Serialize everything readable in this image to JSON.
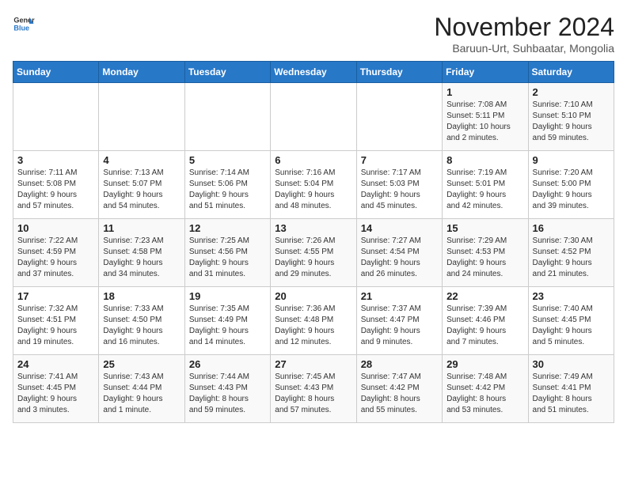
{
  "logo": {
    "line1": "General",
    "line2": "Blue"
  },
  "title": "November 2024",
  "subtitle": "Baruun-Urt, Suhbaatar, Mongolia",
  "weekdays": [
    "Sunday",
    "Monday",
    "Tuesday",
    "Wednesday",
    "Thursday",
    "Friday",
    "Saturday"
  ],
  "weeks": [
    [
      {
        "day": "",
        "info": ""
      },
      {
        "day": "",
        "info": ""
      },
      {
        "day": "",
        "info": ""
      },
      {
        "day": "",
        "info": ""
      },
      {
        "day": "",
        "info": ""
      },
      {
        "day": "1",
        "info": "Sunrise: 7:08 AM\nSunset: 5:11 PM\nDaylight: 10 hours\nand 2 minutes."
      },
      {
        "day": "2",
        "info": "Sunrise: 7:10 AM\nSunset: 5:10 PM\nDaylight: 9 hours\nand 59 minutes."
      }
    ],
    [
      {
        "day": "3",
        "info": "Sunrise: 7:11 AM\nSunset: 5:08 PM\nDaylight: 9 hours\nand 57 minutes."
      },
      {
        "day": "4",
        "info": "Sunrise: 7:13 AM\nSunset: 5:07 PM\nDaylight: 9 hours\nand 54 minutes."
      },
      {
        "day": "5",
        "info": "Sunrise: 7:14 AM\nSunset: 5:06 PM\nDaylight: 9 hours\nand 51 minutes."
      },
      {
        "day": "6",
        "info": "Sunrise: 7:16 AM\nSunset: 5:04 PM\nDaylight: 9 hours\nand 48 minutes."
      },
      {
        "day": "7",
        "info": "Sunrise: 7:17 AM\nSunset: 5:03 PM\nDaylight: 9 hours\nand 45 minutes."
      },
      {
        "day": "8",
        "info": "Sunrise: 7:19 AM\nSunset: 5:01 PM\nDaylight: 9 hours\nand 42 minutes."
      },
      {
        "day": "9",
        "info": "Sunrise: 7:20 AM\nSunset: 5:00 PM\nDaylight: 9 hours\nand 39 minutes."
      }
    ],
    [
      {
        "day": "10",
        "info": "Sunrise: 7:22 AM\nSunset: 4:59 PM\nDaylight: 9 hours\nand 37 minutes."
      },
      {
        "day": "11",
        "info": "Sunrise: 7:23 AM\nSunset: 4:58 PM\nDaylight: 9 hours\nand 34 minutes."
      },
      {
        "day": "12",
        "info": "Sunrise: 7:25 AM\nSunset: 4:56 PM\nDaylight: 9 hours\nand 31 minutes."
      },
      {
        "day": "13",
        "info": "Sunrise: 7:26 AM\nSunset: 4:55 PM\nDaylight: 9 hours\nand 29 minutes."
      },
      {
        "day": "14",
        "info": "Sunrise: 7:27 AM\nSunset: 4:54 PM\nDaylight: 9 hours\nand 26 minutes."
      },
      {
        "day": "15",
        "info": "Sunrise: 7:29 AM\nSunset: 4:53 PM\nDaylight: 9 hours\nand 24 minutes."
      },
      {
        "day": "16",
        "info": "Sunrise: 7:30 AM\nSunset: 4:52 PM\nDaylight: 9 hours\nand 21 minutes."
      }
    ],
    [
      {
        "day": "17",
        "info": "Sunrise: 7:32 AM\nSunset: 4:51 PM\nDaylight: 9 hours\nand 19 minutes."
      },
      {
        "day": "18",
        "info": "Sunrise: 7:33 AM\nSunset: 4:50 PM\nDaylight: 9 hours\nand 16 minutes."
      },
      {
        "day": "19",
        "info": "Sunrise: 7:35 AM\nSunset: 4:49 PM\nDaylight: 9 hours\nand 14 minutes."
      },
      {
        "day": "20",
        "info": "Sunrise: 7:36 AM\nSunset: 4:48 PM\nDaylight: 9 hours\nand 12 minutes."
      },
      {
        "day": "21",
        "info": "Sunrise: 7:37 AM\nSunset: 4:47 PM\nDaylight: 9 hours\nand 9 minutes."
      },
      {
        "day": "22",
        "info": "Sunrise: 7:39 AM\nSunset: 4:46 PM\nDaylight: 9 hours\nand 7 minutes."
      },
      {
        "day": "23",
        "info": "Sunrise: 7:40 AM\nSunset: 4:45 PM\nDaylight: 9 hours\nand 5 minutes."
      }
    ],
    [
      {
        "day": "24",
        "info": "Sunrise: 7:41 AM\nSunset: 4:45 PM\nDaylight: 9 hours\nand 3 minutes."
      },
      {
        "day": "25",
        "info": "Sunrise: 7:43 AM\nSunset: 4:44 PM\nDaylight: 9 hours\nand 1 minute."
      },
      {
        "day": "26",
        "info": "Sunrise: 7:44 AM\nSunset: 4:43 PM\nDaylight: 8 hours\nand 59 minutes."
      },
      {
        "day": "27",
        "info": "Sunrise: 7:45 AM\nSunset: 4:43 PM\nDaylight: 8 hours\nand 57 minutes."
      },
      {
        "day": "28",
        "info": "Sunrise: 7:47 AM\nSunset: 4:42 PM\nDaylight: 8 hours\nand 55 minutes."
      },
      {
        "day": "29",
        "info": "Sunrise: 7:48 AM\nSunset: 4:42 PM\nDaylight: 8 hours\nand 53 minutes."
      },
      {
        "day": "30",
        "info": "Sunrise: 7:49 AM\nSunset: 4:41 PM\nDaylight: 8 hours\nand 51 minutes."
      }
    ]
  ]
}
